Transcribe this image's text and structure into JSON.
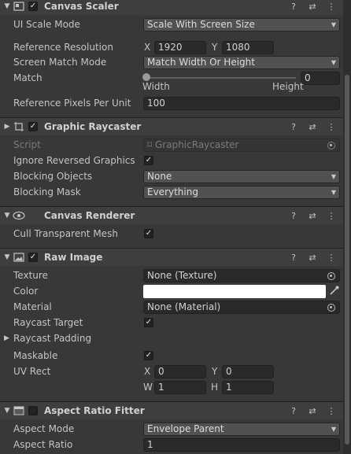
{
  "colors": {
    "panel_bg": "#383838",
    "header_bg": "#3e3e3e",
    "field_bg": "#2a2a2a",
    "dropdown_bg": "#515151",
    "raw_color": "#ffffff"
  },
  "canvas_scaler": {
    "title": "Canvas Scaler",
    "enabled": "✓",
    "ui_scale_mode_label": "UI Scale Mode",
    "ui_scale_mode": "Scale With Screen Size",
    "ref_res_label": "Reference Resolution",
    "x_label": "X",
    "x": "1920",
    "y_label": "Y",
    "y": "1080",
    "screen_match_label": "Screen Match Mode",
    "screen_match": "Match Width Or Height",
    "match_label": "Match",
    "match_value": "0",
    "match_min_label": "Width",
    "match_max_label": "Height",
    "ref_ppu_label": "Reference Pixels Per Unit",
    "ref_ppu": "100"
  },
  "graphic_raycaster": {
    "title": "Graphic Raycaster",
    "enabled": "✓",
    "script_label": "Script",
    "script": "GraphicRaycaster",
    "ignore_reversed_label": "Ignore Reversed Graphics",
    "ignore_reversed": "✓",
    "blocking_objects_label": "Blocking Objects",
    "blocking_objects": "None",
    "blocking_mask_label": "Blocking Mask",
    "blocking_mask": "Everything"
  },
  "canvas_renderer": {
    "title": "Canvas Renderer",
    "cull_label": "Cull Transparent Mesh",
    "cull": "✓"
  },
  "raw_image": {
    "title": "Raw Image",
    "enabled": "✓",
    "texture_label": "Texture",
    "texture": "None (Texture)",
    "color_label": "Color",
    "material_label": "Material",
    "material": "None (Material)",
    "raycast_target_label": "Raycast Target",
    "raycast_target": "✓",
    "raycast_padding_label": "Raycast Padding",
    "maskable_label": "Maskable",
    "maskable": "✓",
    "uv_rect_label": "UV Rect",
    "uv_x_label": "X",
    "uv_x": "0",
    "uv_y_label": "Y",
    "uv_y": "0",
    "uv_w_label": "W",
    "uv_w": "1",
    "uv_h_label": "H",
    "uv_h": "1"
  },
  "aspect_ratio_fitter": {
    "title": "Aspect Ratio Fitter",
    "enabled": "",
    "mode_label": "Aspect Mode",
    "mode": "Envelope Parent",
    "ratio_label": "Aspect Ratio",
    "ratio": "1"
  },
  "header_icons": {
    "help": "?",
    "settings": "⇄",
    "more": "⋮"
  }
}
